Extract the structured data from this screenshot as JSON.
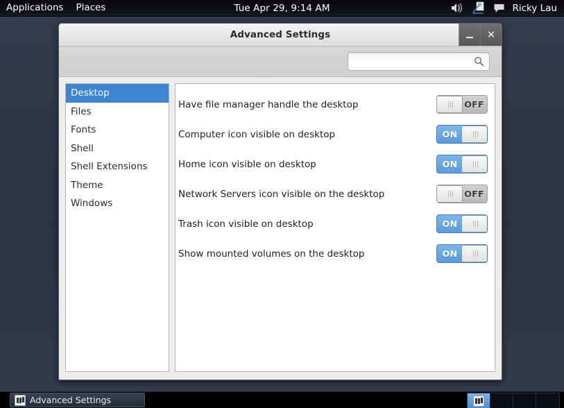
{
  "top_panel": {
    "menus": [
      "Applications",
      "Places"
    ],
    "clock": "Tue Apr 29,  9:14 AM",
    "tray_icons": [
      "volume-icon",
      "network-icon",
      "chat-icon"
    ],
    "user": "Ricky Lau"
  },
  "window": {
    "title": "Advanced Settings",
    "buttons": {
      "minimize": "–",
      "close": "✕"
    },
    "search": {
      "value": "",
      "placeholder": ""
    }
  },
  "sidebar": {
    "items": [
      {
        "label": "Desktop",
        "selected": true
      },
      {
        "label": "Files",
        "selected": false
      },
      {
        "label": "Fonts",
        "selected": false
      },
      {
        "label": "Shell",
        "selected": false
      },
      {
        "label": "Shell Extensions",
        "selected": false
      },
      {
        "label": "Theme",
        "selected": false
      },
      {
        "label": "Windows",
        "selected": false
      }
    ]
  },
  "content": {
    "settings": [
      {
        "label": "Have file manager handle the desktop",
        "state": "OFF"
      },
      {
        "label": "Computer icon visible on desktop",
        "state": "ON"
      },
      {
        "label": "Home icon visible on desktop",
        "state": "ON"
      },
      {
        "label": "Network Servers icon visible on the desktop",
        "state": "OFF"
      },
      {
        "label": "Trash icon visible on desktop",
        "state": "ON"
      },
      {
        "label": "Show mounted volumes on the desktop",
        "state": "ON"
      }
    ]
  },
  "bottom_panel": {
    "task": "Advanced Settings",
    "workspaces": [
      {
        "active": true
      },
      {
        "active": false
      },
      {
        "active": false
      },
      {
        "active": false
      }
    ]
  },
  "colors": {
    "accent_blue": "#3d85d0",
    "toggle_on": "#5a9bdd",
    "desktop_bg": "#2e3847",
    "panel_bg": "#0b0d11"
  }
}
